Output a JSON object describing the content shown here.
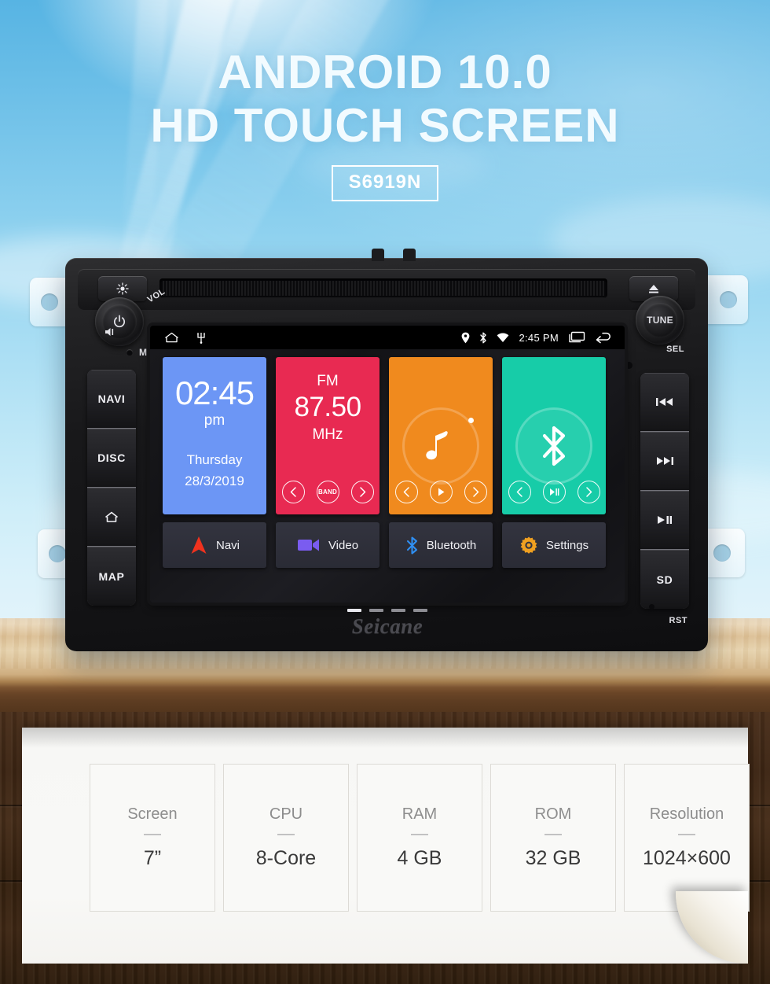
{
  "hero": {
    "title_line1": "ANDROID 10.0",
    "title_line2": "HD TOUCH SCREEN",
    "model_badge": "S6919N"
  },
  "device": {
    "brand_logo": "Seicane",
    "top_bezel": {
      "brightness_button": "brightness-icon",
      "eject_button": "eject-icon",
      "disc_slot": "disc-slot"
    },
    "left_panel": {
      "knob_label": "VOL",
      "knob_icon": "power-icon",
      "mute_icon": "mute-icon",
      "mic_label": "MIC",
      "buttons": [
        {
          "label": "NAVI"
        },
        {
          "label": "DISC"
        },
        {
          "label": "",
          "icon": "home-icon"
        },
        {
          "label": "MAP"
        }
      ]
    },
    "right_panel": {
      "knob_label": "TUNE",
      "sel_label": "SEL",
      "reset_label": "RST",
      "buttons": [
        {
          "label": "",
          "icon": "previous-track-icon"
        },
        {
          "label": "",
          "icon": "next-track-icon"
        },
        {
          "label": "",
          "icon": "play-pause-icon"
        },
        {
          "label": "SD"
        }
      ]
    }
  },
  "screen": {
    "statusbar": {
      "home_icon": "home-icon",
      "usb_icon": "usb-icon",
      "location_icon": "location-pin-icon",
      "bluetooth_icon": "bluetooth-icon",
      "wifi_icon": "wifi-icon",
      "time": "2:45 PM",
      "recents_icon": "recents-icon",
      "back_icon": "back-icon"
    },
    "tiles": [
      {
        "name": "clock",
        "color": "#6c96f5",
        "time": "02:45",
        "ampm": "pm",
        "weekday": "Thursday",
        "date": "28/3/2019"
      },
      {
        "name": "radio",
        "color": "#e82a52",
        "band": "FM",
        "frequency": "87.50",
        "unit": "MHz",
        "controls": [
          "prev",
          "BAND",
          "next"
        ]
      },
      {
        "name": "music",
        "color": "#f08a1e",
        "icon": "music-note-icon",
        "controls": [
          "prev",
          "play",
          "next"
        ]
      },
      {
        "name": "bluetooth",
        "color": "#17cca8",
        "icon": "bluetooth-icon",
        "controls": [
          "prev",
          "play-pause",
          "next"
        ]
      }
    ],
    "shortcuts": [
      {
        "label": "Navi",
        "icon": "navigation-arrow-icon",
        "color": "#f0321e"
      },
      {
        "label": "Video",
        "icon": "video-camera-icon",
        "color": "#7a5cf0"
      },
      {
        "label": "Bluetooth",
        "icon": "bluetooth-icon",
        "color": "#2f8ef0"
      },
      {
        "label": "Settings",
        "icon": "gear-icon",
        "color": "#f0a020"
      }
    ]
  },
  "specs": [
    {
      "label": "Screen",
      "value": "7”"
    },
    {
      "label": "CPU",
      "value": "8-Core"
    },
    {
      "label": "RAM",
      "value": "4 GB"
    },
    {
      "label": "ROM",
      "value": "32 GB"
    },
    {
      "label": "Resolution",
      "value": "1024×600"
    }
  ]
}
